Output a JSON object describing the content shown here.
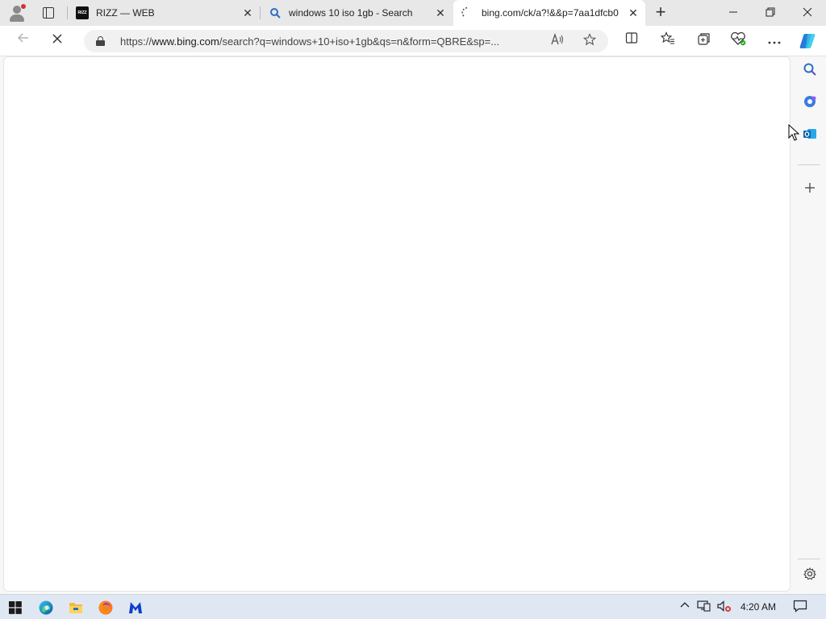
{
  "browser": {
    "tabs": [
      {
        "title": "RIZZ — WEB",
        "favicon": "rizz-logo",
        "active": false
      },
      {
        "title": "windows 10 iso 1gb - Search",
        "favicon": "bing-search-icon",
        "active": false
      },
      {
        "title": "bing.com/ck/a?!&&p=7aa1dfcb0",
        "favicon": "loading-spinner",
        "active": true
      }
    ],
    "address": {
      "host_prefix": "https://",
      "host": "www.bing.com",
      "path": "/search?q=windows+10+iso+1gb&qs=n&form=QBRE&sp=..."
    },
    "new_tab_glyph": "+",
    "window_controls": {
      "minimize": "—",
      "restore": "❐",
      "close": "✕"
    }
  },
  "taskbar": {
    "clock": "4:20 AM"
  },
  "colors": {
    "tabbar_bg": "#e8e8e8",
    "active_tab_bg": "#ffffff",
    "taskbar_bg": "#dfe8f2",
    "accent": "#2b6fc4"
  }
}
